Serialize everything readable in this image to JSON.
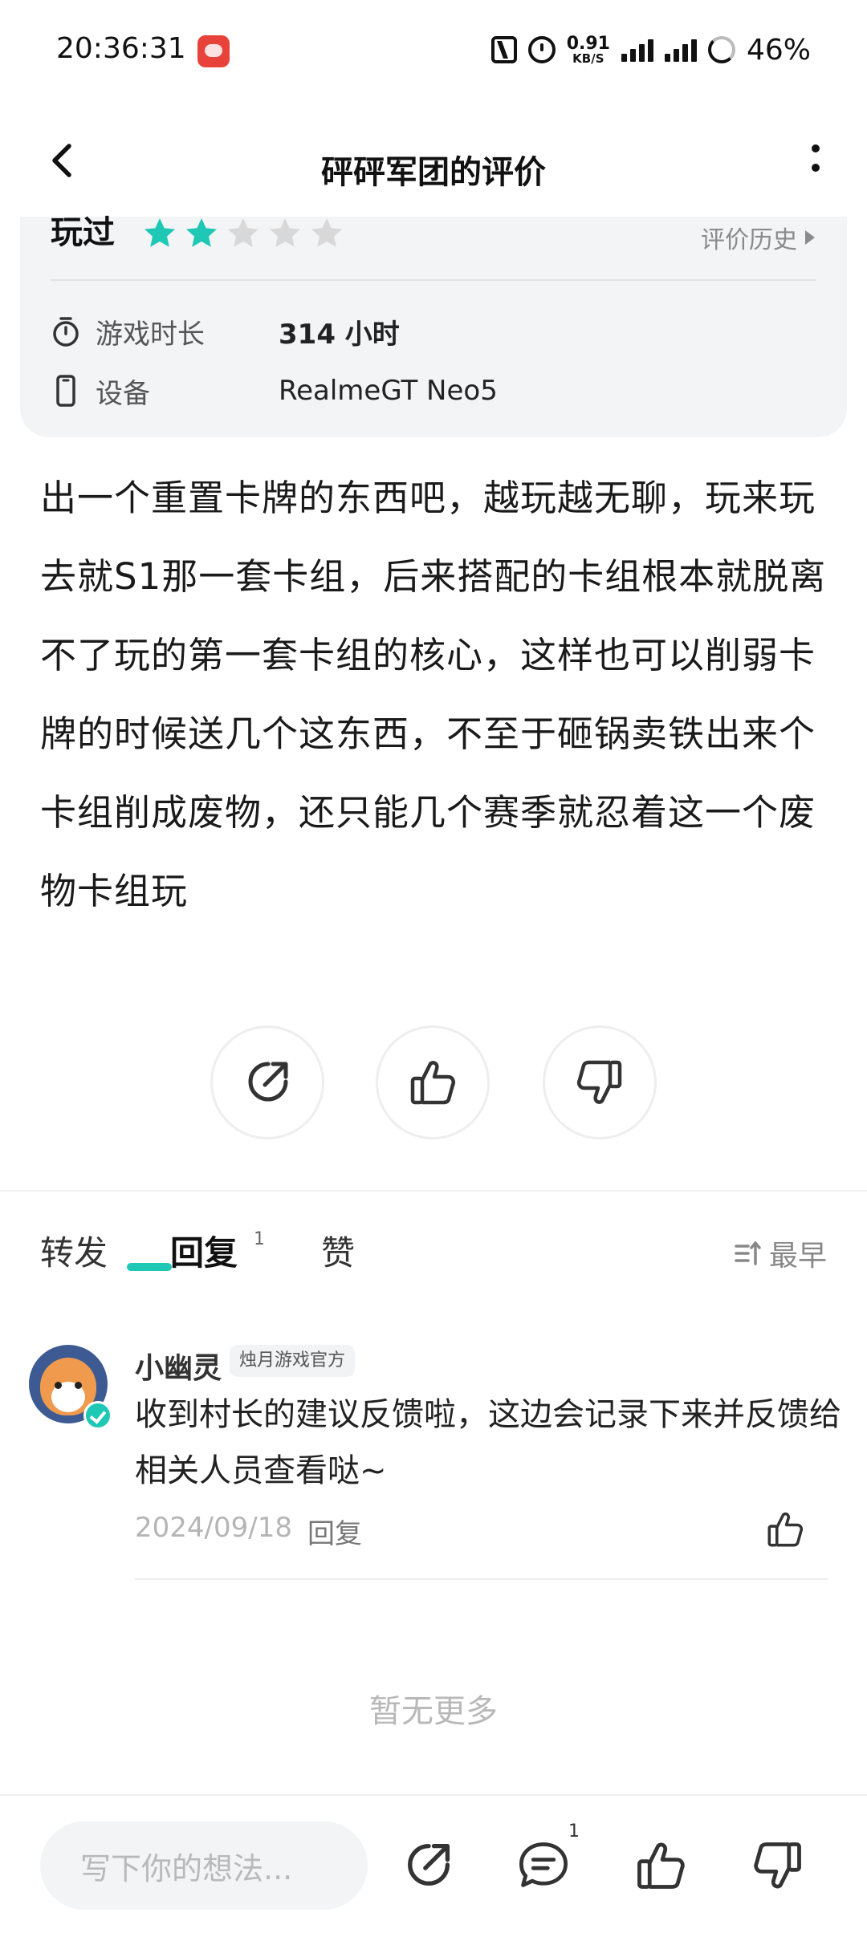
{
  "status_bar": {
    "time": "20:36:31",
    "net_speed_value": "0.91",
    "net_speed_unit": "KB/S",
    "battery": "46%"
  },
  "nav": {
    "title": "砰砰军团的评价",
    "back_icon": "back-chevron-icon",
    "more_icon": "more-vertical-icon"
  },
  "review_card": {
    "played_label": "玩过",
    "rating": 2,
    "max_rating": 5,
    "star_colors": {
      "filled": "#1ec8b5",
      "empty": "#d8d8d8"
    },
    "history_link": "评价历史",
    "playtime_label": "游戏时长",
    "playtime_value": "314 小时",
    "device_label": "设备",
    "device_value": "RealmeGT Neo5"
  },
  "review_text": "出一个重置卡牌的东西吧，越玩越无聊，玩来玩去就S1那一套卡组，后来搭配的卡组根本就脱离不了玩的第一套卡组的核心，这样也可以削弱卡牌的时候送几个这东西，不至于砸锅卖铁出来个卡组削成废物，还只能几个赛季就忍着这一个废物卡组玩",
  "tabs": {
    "forward": "转发",
    "reply": "回复",
    "reply_count": "1",
    "like": "赞",
    "sort": "最早"
  },
  "comment": {
    "name": "小幽灵",
    "badge": "烛月游戏官方",
    "text": "收到村长的建议反馈啦，这边会记录下来并反馈给相关人员查看哒~",
    "date": "2024/09/18",
    "reply_label": "回复"
  },
  "no_more": "暂无更多",
  "bottom_bar": {
    "input_placeholder": "写下你的想法...",
    "reply_count": "1"
  },
  "accent_color": "#1ec8b5"
}
